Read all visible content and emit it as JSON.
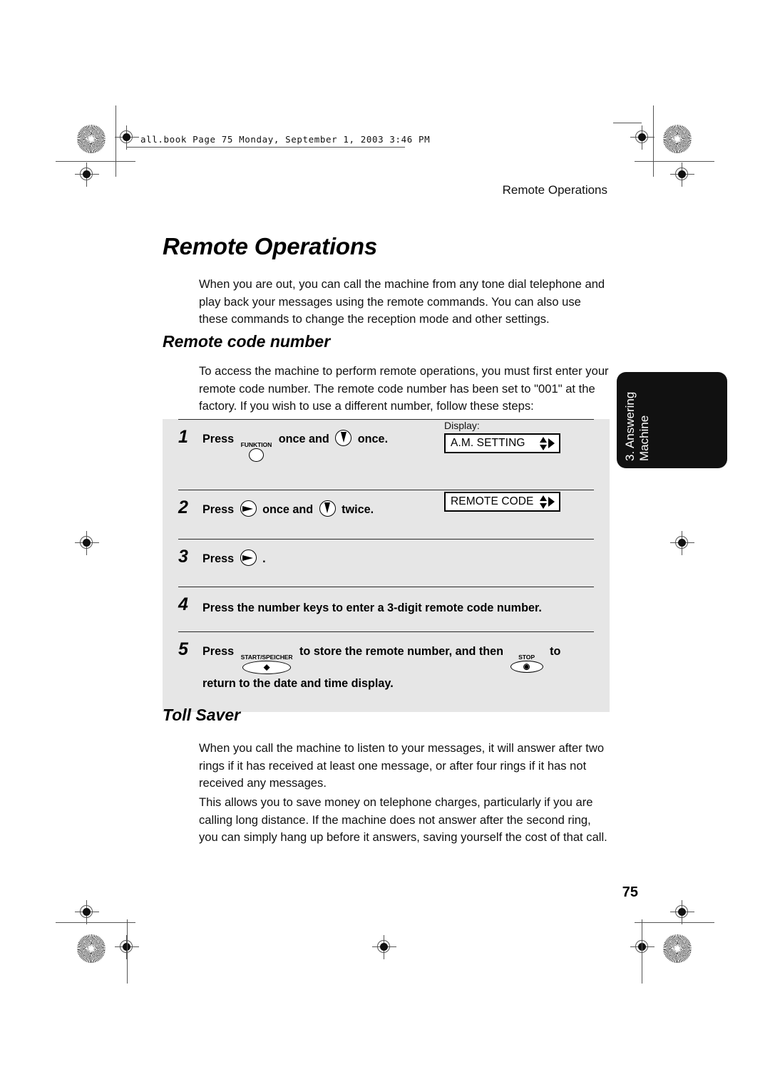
{
  "file_banner": "all.book  Page 75  Monday, September 1, 2003  3:46 PM",
  "running_head": "Remote Operations",
  "chapter_title": "Remote Operations",
  "intro_paragraph": "When you are out, you can call the machine from any tone dial telephone and play back your messages using the remote commands. You can also use these commands to change the reception mode and other settings.",
  "sections": [
    {
      "heading": "Remote code number",
      "paragraph": "To access the machine to perform remote operations, you must first enter your remote code number. The remote code number has been set to \"001\" at the factory. If you wish to use a different number, follow these steps:"
    },
    {
      "heading": "Toll Saver",
      "paragraph_1": "When you call the machine to listen to your messages, it will answer after two rings if it has received at least one message, or after four rings if it has not received any messages.",
      "paragraph_2": "This allows you to save money on telephone charges, particularly if you are calling long distance. If the machine does not answer after the second ring, you can simply hang up before it answers, saving yourself the cost of that call."
    }
  ],
  "steps": {
    "display_label": "Display:",
    "rows": [
      {
        "number": "1",
        "text_before": "Press",
        "key1_cap": "FUNKTION",
        "text_mid": "once and",
        "key2_icon": "down-arrow-key",
        "text_after": "once.",
        "display_value": "A.M. SETTING"
      },
      {
        "number": "2",
        "text_before": "Press",
        "key1_icon": "right-arrow-key",
        "text_mid": "once and",
        "key2_icon": "down-arrow-key",
        "text_after": "twice.",
        "display_value": "REMOTE CODE"
      },
      {
        "number": "3",
        "text_before": "Press",
        "key1_icon": "right-arrow-key",
        "text_after": "."
      },
      {
        "number": "4",
        "text_full": "Press the number keys to enter a 3-digit remote code number."
      },
      {
        "number": "5",
        "text_before": "Press",
        "key1_cap": "START/SPEICHER",
        "text_mid": "to store the remote number, and then",
        "key2_cap": "STOP",
        "text_after": "to return to the date and time display."
      }
    ]
  },
  "side_tab": {
    "line_1": "3. Answering",
    "line_2": "Machine"
  },
  "page_number": "75",
  "colors": {
    "step_table_background": "#e6e6e6",
    "side_tab_background": "#111111",
    "rule": "#2a2a2a"
  }
}
